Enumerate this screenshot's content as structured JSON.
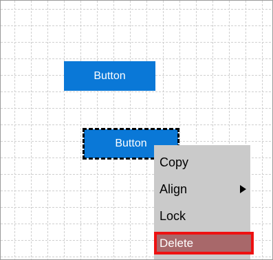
{
  "canvas": {
    "buttons": [
      {
        "label": "Button"
      },
      {
        "label": "Button"
      }
    ]
  },
  "context_menu": {
    "items": [
      {
        "label": "Copy"
      },
      {
        "label": "Align",
        "icon": "submenu-arrow-icon"
      },
      {
        "label": "Lock"
      },
      {
        "label": "Delete",
        "highlighted": true
      }
    ]
  },
  "colors": {
    "button_bg": "#0a78d7",
    "menu_bg": "#cacaca",
    "delete_highlight_bg": "#a8686a",
    "delete_highlight_border": "#ee1111",
    "grid_line": "#cfcfcf"
  }
}
